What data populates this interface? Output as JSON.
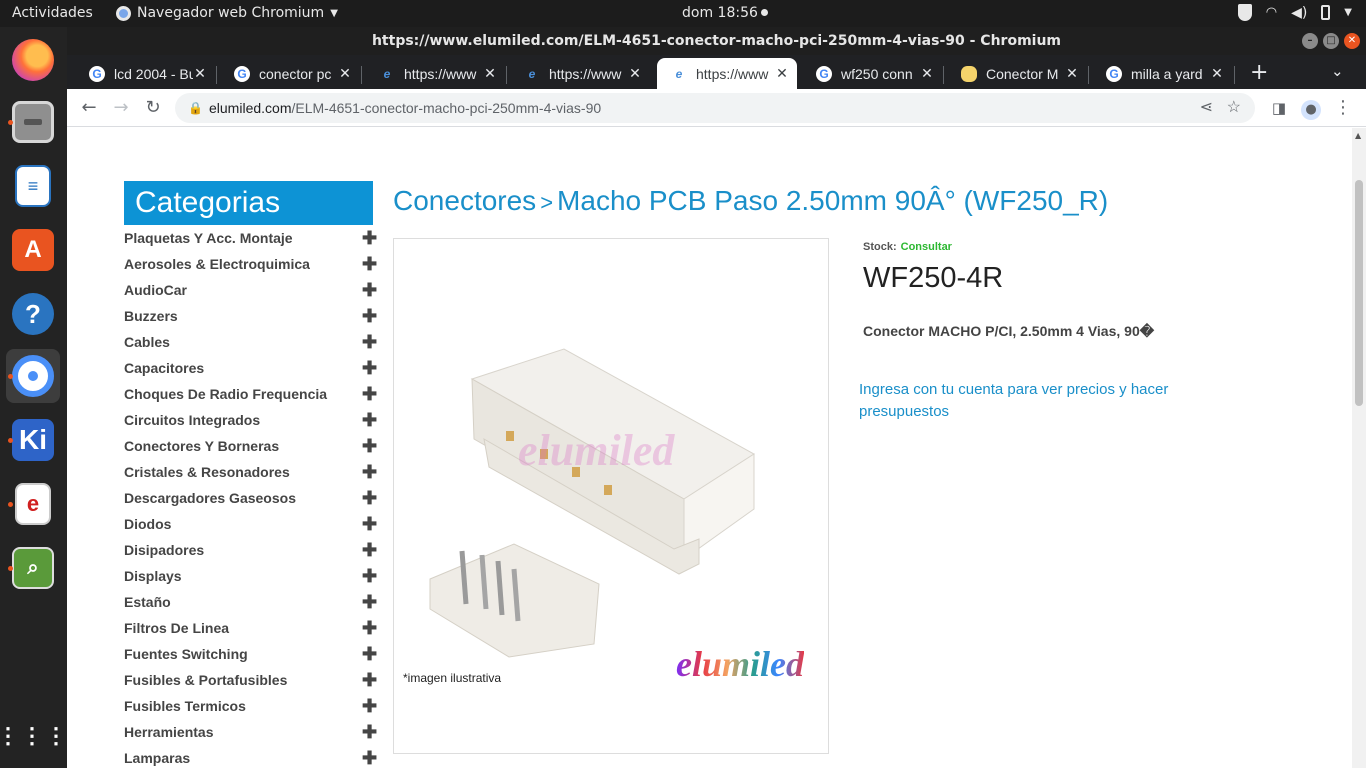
{
  "topbar": {
    "activities": "Actividades",
    "app_name": "Navegador web Chromium",
    "clock": "dom 18:56"
  },
  "dock": {
    "items": [
      "firefox-icon",
      "files-icon",
      "writer-icon",
      "software-center-icon",
      "help-icon",
      "chromium-icon",
      "kicad-icon",
      "evince-icon",
      "gerbview-icon",
      "show-apps-icon"
    ]
  },
  "window": {
    "title": "https://www.elumiled.com/ELM-4651-conector-macho-pci-250mm-4-vias-90 - Chromium"
  },
  "tabs": [
    {
      "title": "lcd 2004 - Bu",
      "favicon": "google"
    },
    {
      "title": "conector pc",
      "favicon": "google"
    },
    {
      "title": "https://www",
      "favicon": "elumiled"
    },
    {
      "title": "https://www",
      "favicon": "elumiled"
    },
    {
      "title": "https://www",
      "favicon": "elumiled",
      "active": true
    },
    {
      "title": "wf250 conn",
      "favicon": "google"
    },
    {
      "title": "Conector M",
      "favicon": "shop"
    },
    {
      "title": "milla a yard",
      "favicon": "google"
    }
  ],
  "toolbar": {
    "url_host": "elumiled.com",
    "url_path": "/ELM-4651-conector-macho-pci-250mm-4-vias-90"
  },
  "sidebar": {
    "title": "Categorias",
    "items": [
      "Plaquetas Y Acc. Montaje",
      "Aerosoles & Electroquimica",
      "AudioCar",
      "Buzzers",
      "Cables",
      "Capacitores",
      "Choques De Radio Frequencia",
      "Circuitos Integrados",
      "Conectores Y Borneras",
      "Cristales & Resonadores",
      "Descargadores Gaseosos",
      "Diodos",
      "Disipadores",
      "Displays",
      "Estaño",
      "Filtros De Linea",
      "Fuentes Switching",
      "Fusibles & Portafusibles",
      "Fusibles Termicos",
      "Herramientas",
      "Lamparas"
    ]
  },
  "product": {
    "breadcrumb_parent": "Conectores",
    "breadcrumb_sep": ">",
    "breadcrumb_current": "Macho PCB Paso 2.50mm 90Â° (WF250_R)",
    "image_note": "*imagen ilustrativa",
    "watermark": "elumiled",
    "logo": "elumiled",
    "stock_label": "Stock:",
    "stock_value": "Consultar",
    "sku": "WF250-4R",
    "description": "Conector MACHO P/CI, 2.50mm 4 Vias, 90�",
    "login_prompt": "Ingresa con tu cuenta para ver precios y hacer presupuestos"
  },
  "colors": {
    "accent": "#0d93d5",
    "link": "#1a8fc9",
    "stock_ok": "#2db832",
    "ubuntu_orange": "#e95420"
  }
}
